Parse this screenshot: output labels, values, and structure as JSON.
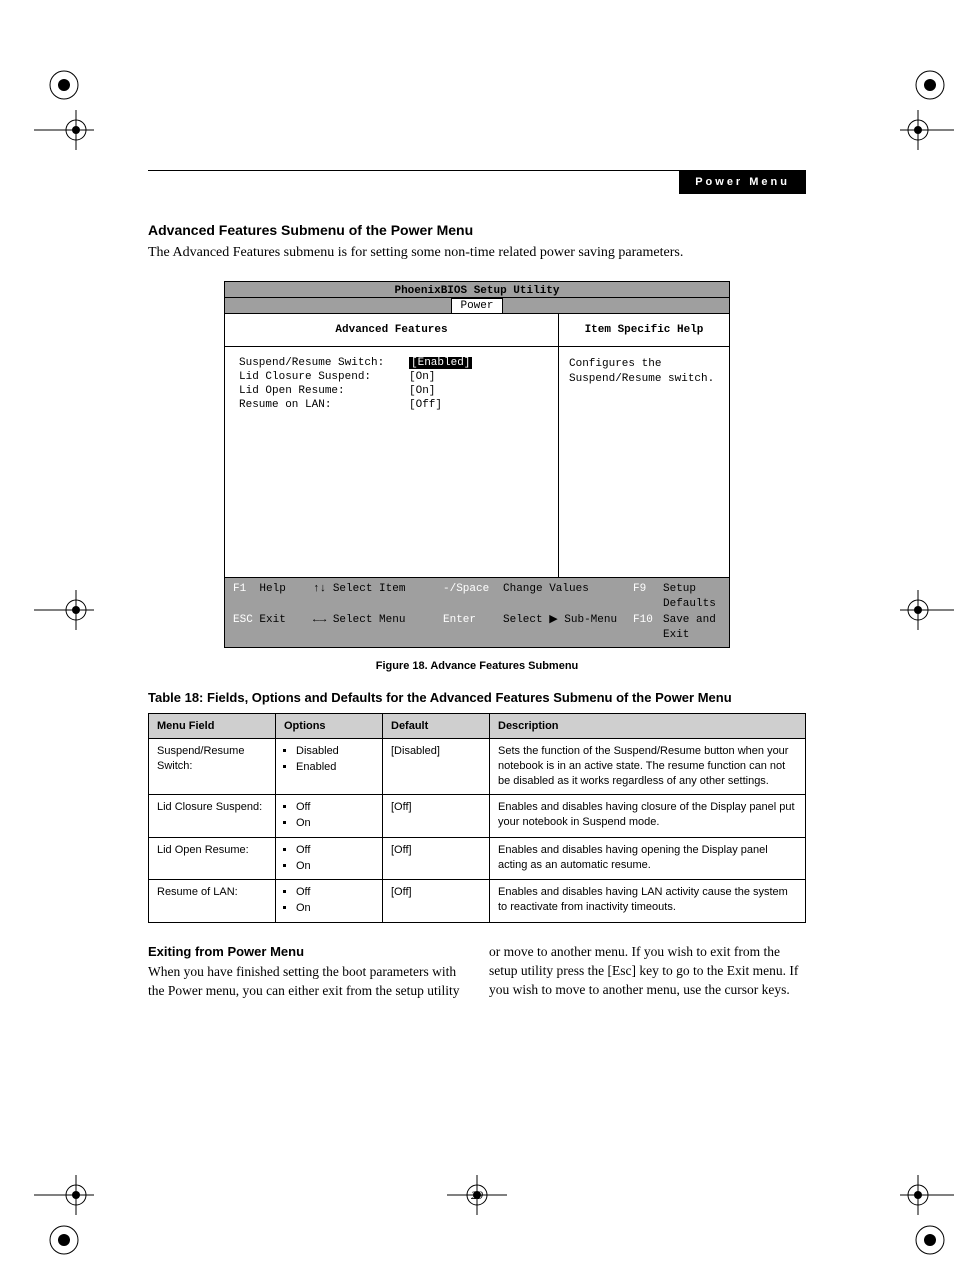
{
  "section_tag": "Power Menu",
  "heading": "Advanced Features Submenu of the Power Menu",
  "intro": "The Advanced Features submenu is for setting some non-time related power saving parameters.",
  "bios": {
    "title": "PhoenixBIOS Setup Utility",
    "tab": "Power",
    "left_title": "Advanced Features",
    "right_title": "Item Specific Help",
    "help_text": "Configures the Suspend/Resume switch.",
    "items": [
      {
        "label": "Suspend/Resume Switch:",
        "value": "[Enabled]",
        "selected": true
      },
      {
        "label": "Lid Closure Suspend:",
        "value": "[On]",
        "selected": false
      },
      {
        "label": "Lid Open Resume:",
        "value": "[On]",
        "selected": false
      },
      {
        "label": "Resume on LAN:",
        "value": "[Off]",
        "selected": false
      }
    ],
    "footer": {
      "r1": {
        "k1": "F1",
        "v1": "Help",
        "k2": "↑↓",
        "v2": "Select Item",
        "k3": "-/Space",
        "v3": "Change Values",
        "k4": "F9",
        "v4": "Setup Defaults"
      },
      "r2": {
        "k1": "ESC",
        "v1": "Exit",
        "k2": "←→",
        "v2": "Select Menu",
        "k3": "Enter",
        "v3": "Select ▶ Sub-Menu",
        "k4": "F10",
        "v4": "Save and Exit"
      }
    }
  },
  "figure_caption": "Figure 18.   Advance Features Submenu",
  "table_title": "Table 18: Fields, Options and Defaults for the Advanced Features Submenu of the Power Menu",
  "table": {
    "headers": {
      "c1": "Menu Field",
      "c2": "Options",
      "c3": "Default",
      "c4": "Description"
    },
    "rows": [
      {
        "field": "Suspend/Resume Switch:",
        "options": [
          "Disabled",
          "Enabled"
        ],
        "default": "[Disabled]",
        "desc": "Sets the function of the Suspend/Resume button when your notebook is in an active state. The resume function can not be disabled as it works regardless of any other settings."
      },
      {
        "field": "Lid Closure Suspend:",
        "options": [
          "Off",
          "On"
        ],
        "default": "[Off]",
        "desc": "Enables and disables having closure of the Display panel put your notebook in Suspend mode."
      },
      {
        "field": "Lid Open Resume:",
        "options": [
          "Off",
          "On"
        ],
        "default": "[Off]",
        "desc": "Enables and disables having opening the Display panel acting as an automatic resume."
      },
      {
        "field": "Resume of LAN:",
        "options": [
          "Off",
          "On"
        ],
        "default": "[Off]",
        "desc": "Enables and disables having LAN activity cause the system to reactivate from inactivity timeouts."
      }
    ]
  },
  "exit_heading": "Exiting from Power Menu",
  "exit_body_a": "When you have finished setting the boot parameters with the Power menu, you can either exit from the setup utility or move to another menu. If you wish to exit from ",
  "exit_body_b": "the setup utility press the [Esc] key to go to the Exit menu. If you wish to move to another menu, use the cursor keys.",
  "page_number": "29"
}
